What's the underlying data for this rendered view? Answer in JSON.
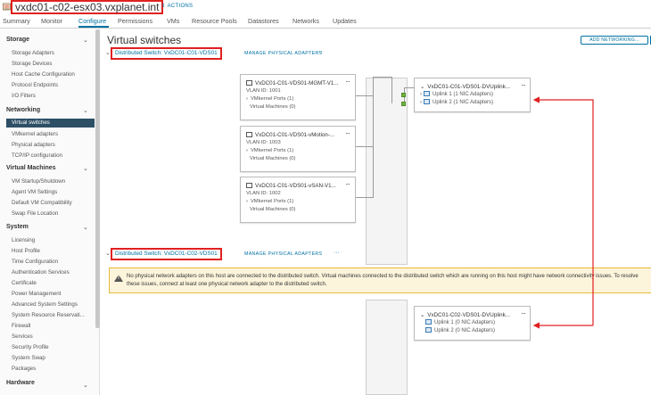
{
  "header": {
    "host_name": "vxdc01-c02-esx03.vxplanet.int",
    "actions_label": "ACTIONS"
  },
  "tabs": [
    "Summary",
    "Monitor",
    "Configure",
    "Permissions",
    "VMs",
    "Resource Pools",
    "Datastores",
    "Networks",
    "Updates"
  ],
  "active_tab": "Configure",
  "sidebar": {
    "storage": {
      "title": "Storage",
      "items": [
        "Storage Adapters",
        "Storage Devices",
        "Host Cache Configuration",
        "Protocol Endpoints",
        "I/O Filters"
      ]
    },
    "networking": {
      "title": "Networking",
      "items": [
        "Virtual switches",
        "VMkernel adapters",
        "Physical adapters",
        "TCP/IP configuration"
      ]
    },
    "virtual_machines": {
      "title": "Virtual Machines",
      "items": [
        "VM Startup/Shutdown",
        "Agent VM Settings",
        "Default VM Compatibility",
        "Swap File Location"
      ]
    },
    "system": {
      "title": "System",
      "items": [
        "Licensing",
        "Host Profile",
        "Time Configuration",
        "Authentication Services",
        "Certificate",
        "Power Management",
        "Advanced System Settings",
        "System Resource Reservati...",
        "Firewall",
        "Services",
        "Security Profile",
        "System Swap",
        "Packages"
      ]
    },
    "hardware": {
      "title": "Hardware"
    },
    "active_item": "Virtual switches"
  },
  "main": {
    "title": "Virtual switches",
    "add_networking_label": "ADD NETWORKING...",
    "manage_physical_label": "MANAGE PHYSICAL ADAPTERS",
    "more_label": "···",
    "switch1": {
      "name": "Distributed Switch: VxDC01-C01-VDS01",
      "portgroups": [
        {
          "name": "VxDC01-C01-VDS01-MGMT-V1...",
          "vlan": "VLAN ID: 1001",
          "vmk": "VMkernel Ports (1)",
          "vms": "Virtual Machines (0)"
        },
        {
          "name": "VxDC01-C01-VDS01-vMotion-...",
          "vlan": "VLAN ID: 1003",
          "vmk": "VMkernel Ports (1)",
          "vms": "Virtual Machines (0)"
        },
        {
          "name": "VxDC01-C01-VDS01-vSAN-V1...",
          "vlan": "VLAN ID: 1002",
          "vmk": "VMkernel Ports (1)",
          "vms": "Virtual Machines (0)"
        }
      ],
      "uplink": {
        "name": "VxDC01-C01-VDS01-DVUplink...",
        "uplinks": [
          "Uplink 1 (1 NIC Adapters)",
          "Uplink 2 (1 NIC Adapters)"
        ]
      }
    },
    "switch2": {
      "name": "Distributed Switch: VxDC01-C02-VDS01",
      "warning": "No physical network adapters on this host are connected to the distributed switch. Virtual machines connected to the distributed switch which are running on this host might have network connectivity issues. To resolve these issues, connect at least one physical network adapter to the distributed switch.",
      "uplink": {
        "name": "VxDC01-C02-VDS01-DVUplink...",
        "uplinks": [
          "Uplink 1 (0 NIC Adapters)",
          "Uplink 2 (0 NIC Adapters)"
        ]
      }
    }
  },
  "colors": {
    "accent": "#0072a3",
    "highlight": "#e02020",
    "nav_active": "#2d4f66",
    "port": "#6fb83f",
    "warning_bg": "#fdf4dc"
  }
}
